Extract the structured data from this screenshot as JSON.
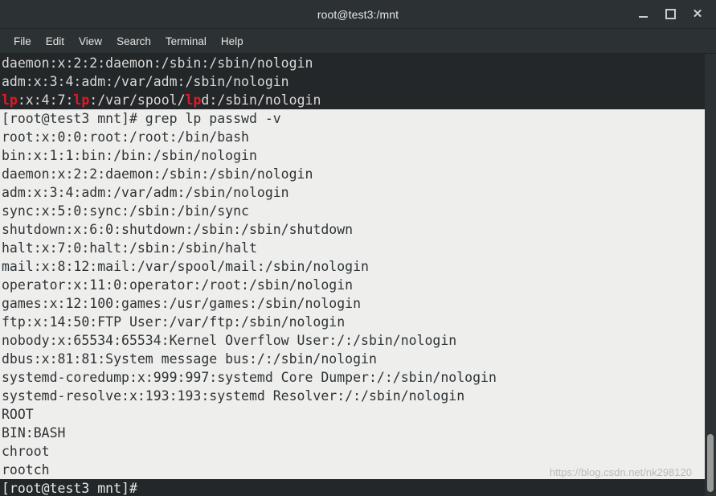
{
  "window": {
    "title": "root@test3:/mnt",
    "controls": [
      {
        "name": "minimize",
        "label": "–"
      },
      {
        "name": "maximize",
        "label": "□"
      },
      {
        "name": "close",
        "label": "×"
      }
    ]
  },
  "menubar": {
    "items": [
      "File",
      "Edit",
      "View",
      "Search",
      "Terminal",
      "Help"
    ]
  },
  "terminal": {
    "prompt": "[root@test3 mnt]#",
    "command": "grep lp passwd -v",
    "highlight_color": "#e01b24",
    "dark_bg": "#232729",
    "light_bg": "#eeeeec",
    "lines": [
      {
        "text": "daemon:x:2:2:daemon:/sbin:/sbin/nologin",
        "style": "dark"
      },
      {
        "text": "adm:x:3:4:adm:/var/adm:/sbin/nologin",
        "style": "dark"
      },
      {
        "text": "lp:x:4:7:lp:/var/spool/lpd:/sbin/nologin",
        "style": "dark",
        "highlight": "lp"
      },
      {
        "text": "[root@test3 mnt]# grep lp passwd -v",
        "style": "light"
      },
      {
        "text": "root:x:0:0:root:/root:/bin/bash",
        "style": "light"
      },
      {
        "text": "bin:x:1:1:bin:/bin:/sbin/nologin",
        "style": "light"
      },
      {
        "text": "daemon:x:2:2:daemon:/sbin:/sbin/nologin",
        "style": "light"
      },
      {
        "text": "adm:x:3:4:adm:/var/adm:/sbin/nologin",
        "style": "light"
      },
      {
        "text": "sync:x:5:0:sync:/sbin:/bin/sync",
        "style": "light"
      },
      {
        "text": "shutdown:x:6:0:shutdown:/sbin:/sbin/shutdown",
        "style": "light"
      },
      {
        "text": "halt:x:7:0:halt:/sbin:/sbin/halt",
        "style": "light"
      },
      {
        "text": "mail:x:8:12:mail:/var/spool/mail:/sbin/nologin",
        "style": "light"
      },
      {
        "text": "operator:x:11:0:operator:/root:/sbin/nologin",
        "style": "light"
      },
      {
        "text": "games:x:12:100:games:/usr/games:/sbin/nologin",
        "style": "light"
      },
      {
        "text": "ftp:x:14:50:FTP User:/var/ftp:/sbin/nologin",
        "style": "light"
      },
      {
        "text": "nobody:x:65534:65534:Kernel Overflow User:/:/sbin/nologin",
        "style": "light"
      },
      {
        "text": "dbus:x:81:81:System message bus:/:/sbin/nologin",
        "style": "light"
      },
      {
        "text": "systemd-coredump:x:999:997:systemd Core Dumper:/:/sbin/nologin",
        "style": "light"
      },
      {
        "text": "systemd-resolve:x:193:193:systemd Resolver:/:/sbin/nologin",
        "style": "light"
      },
      {
        "text": "ROOT",
        "style": "light"
      },
      {
        "text": "BIN:BASH",
        "style": "light"
      },
      {
        "text": "chroot",
        "style": "light"
      },
      {
        "text": "rootch",
        "style": "light"
      },
      {
        "text": "[root@test3 mnt]#",
        "style": "dark-prompt"
      }
    ]
  },
  "scrollbar": {
    "thumb_top_pct": 86,
    "thumb_height_pct": 13
  },
  "watermark": {
    "text": "https://blog.csdn.net/nk298120"
  }
}
